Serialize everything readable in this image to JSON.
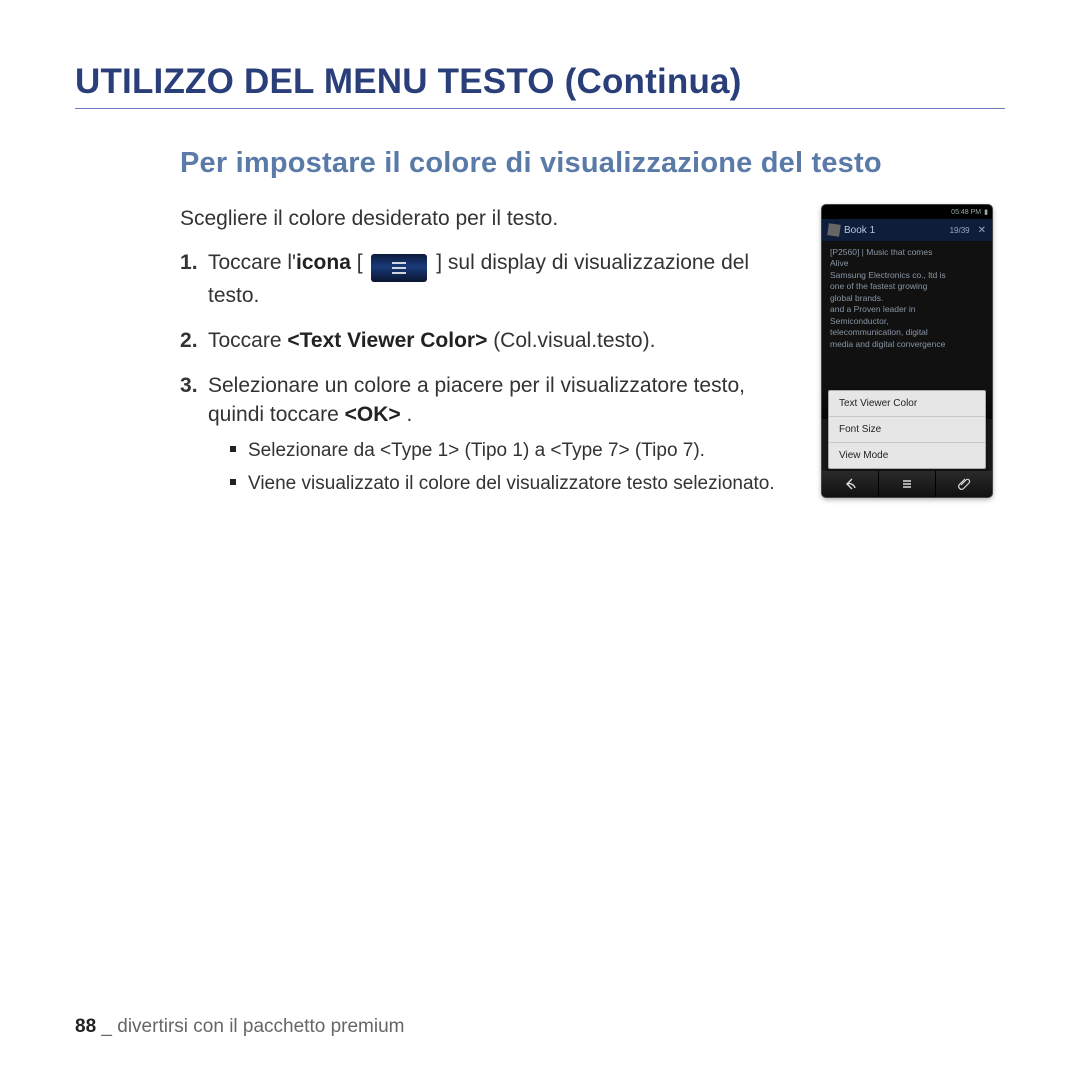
{
  "title": "UTILIZZO DEL MENU TESTO (Continua)",
  "subtitle": "Per impostare il colore di visualizzazione del testo",
  "intro": "Scegliere il colore desiderato per il testo.",
  "steps": {
    "s1a": "Toccare l'",
    "s1b": "icona",
    "s1c": " [",
    "s1d": "] sul display di visualizzazione del testo.",
    "s2a": "Toccare ",
    "s2b": "<Text Viewer Color>",
    "s2c": " (Col.visual.testo).",
    "s3a": "Selezionare un colore a piacere per il visualizzatore testo, quindi toccare ",
    "s3b": "<OK>",
    "s3c": " ."
  },
  "bullets": {
    "b1": "Selezionare da <Type 1> (Tipo 1) a <Type 7> (Tipo 7).",
    "b2": "Viene visualizzato il colore del visualizzatore testo selezionato."
  },
  "device": {
    "status_time": "05:48 PM",
    "title": "Book 1",
    "page_ind": "19/39",
    "close": "✕",
    "content_lines": [
      "[P2560] | Music that comes",
      "Alive",
      "Samsung Electronics co., ltd is",
      "one of the fastest growing",
      "global brands.",
      "and a Proven leader in",
      "Semiconductor,",
      "telecommunication, digital",
      "media and digital convergence"
    ],
    "menu": [
      "Text Viewer Color",
      "Font Size",
      "View Mode"
    ]
  },
  "footer": {
    "pageno": "88",
    "sep": " _ ",
    "chapter": "divertirsi con il pacchetto premium"
  }
}
